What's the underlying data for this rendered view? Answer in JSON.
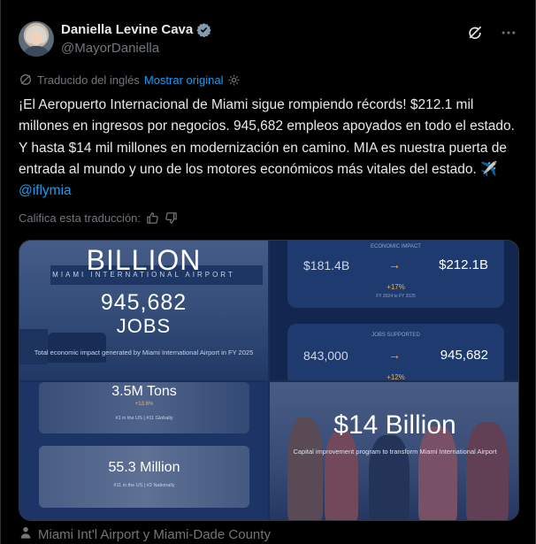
{
  "author": {
    "display_name": "Daniella Levine Cava",
    "handle": "@MayorDaniella"
  },
  "translation": {
    "translated_label": "Traducido del inglés",
    "show_original_label": "Mostrar original",
    "rate_label": "Califica esta traducción:"
  },
  "tweet": {
    "text": "¡El Aeropuerto Internacional de Miami sigue rompiendo récords! $212.1 mil millones en ingresos por negocios. 945,682 empleos apoyados en todo el estado. Y hasta $14 mil millones en modernización en camino. MIA es nuestra puerta de entrada al mundo y uno de los motores económicos más vitales del estado. ✈️",
    "mention": "@iflymia"
  },
  "media": {
    "panel1": {
      "headline": "BILLION",
      "sign_text": "MIAMI INTERNATIONAL AIRPORT",
      "jobs_number": "945,682",
      "jobs_label": "JOBS",
      "caption": "Total economic impact generated by Miami International Airport in FY 2025"
    },
    "panel2": {
      "impact_label": "ECONOMIC IMPACT",
      "impact_from": "$181.4B",
      "impact_to": "$212.1B",
      "impact_change": "+17%",
      "impact_period": "FY 2024 to FY 2025",
      "jobs_label": "JOBS SUPPORTED",
      "jobs_from": "843,000",
      "jobs_to": "945,682",
      "jobs_change": "+12%"
    },
    "panel3": {
      "cargo_value": "3.5M Tons",
      "cargo_change": "+13.6%",
      "cargo_rank": "#1 in the US | #11 Globally",
      "passengers_value": "55.3 Million",
      "passengers_rank": "#11 in the US | #2 Nationally"
    },
    "panel4": {
      "amount": "$14 Billion",
      "caption": "Capital improvement program to transform Miami International Airport"
    }
  },
  "footer": {
    "tagged_people": "Miami Int'l Airport y Miami-Dade County"
  },
  "colors": {
    "background": "#000000",
    "text": "#e7e9ea",
    "muted": "#71767b",
    "link": "#1d9bf0",
    "accent_gold": "#f2b33d",
    "panel_navy": "#1b2f55"
  },
  "icons": {
    "verified": "verified-badge-icon",
    "grok": "grok-icon",
    "more": "more-options-icon",
    "translate": "translate-icon",
    "settings": "settings-gear-icon",
    "thumbs_up": "thumbs-up-icon",
    "thumbs_down": "thumbs-down-icon",
    "person": "person-icon",
    "airplane": "airplane-emoji"
  }
}
